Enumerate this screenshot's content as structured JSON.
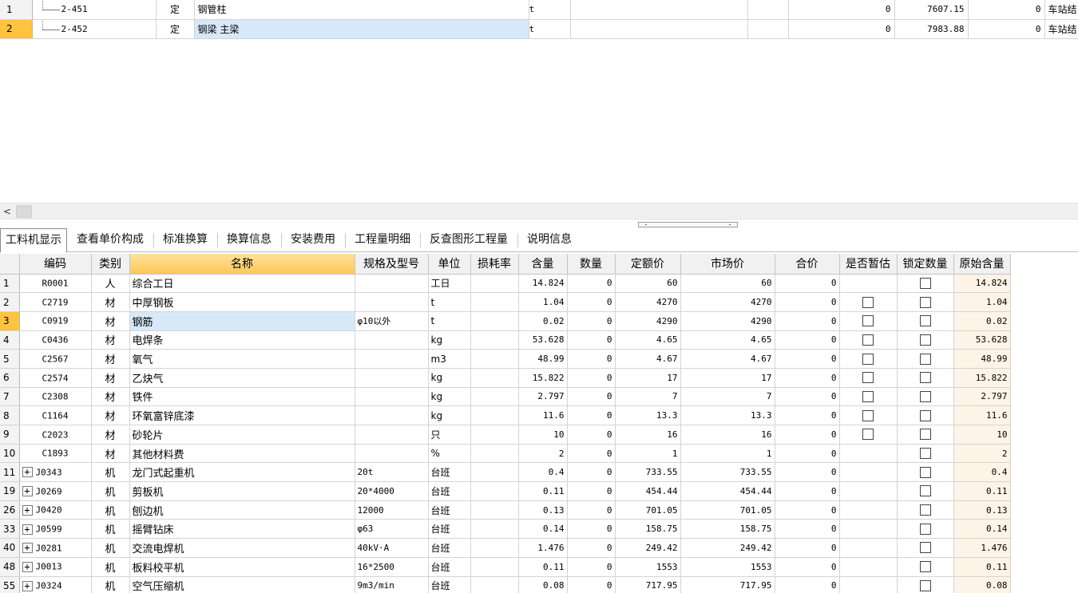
{
  "top_rows": [
    {
      "no": "1",
      "code": "2-451",
      "type": "定",
      "name": "钢管柱",
      "unit": "t",
      "c6": "",
      "c7": "",
      "qty": "0",
      "price": "7607.15",
      "total": "0",
      "category": "车站结"
    },
    {
      "no": "2",
      "code": "2-452",
      "type": "定",
      "name": "钢梁 主梁",
      "unit": "t",
      "c6": "",
      "c7": "",
      "qty": "0",
      "price": "7983.88",
      "total": "0",
      "category": "车站结"
    }
  ],
  "scrollbar": {
    "left_arrow": "<"
  },
  "tabs": [
    {
      "label": "工料机显示",
      "active": true
    },
    {
      "label": "查看单价构成"
    },
    {
      "label": "标准换算"
    },
    {
      "label": "换算信息"
    },
    {
      "label": "安装费用"
    },
    {
      "label": "工程量明细"
    },
    {
      "label": "反查图形工程量"
    },
    {
      "label": "说明信息"
    }
  ],
  "columns": [
    "",
    "编码",
    "类别",
    "名称",
    "规格及型号",
    "单位",
    "损耗率",
    "含量",
    "数量",
    "定额价",
    "市场价",
    "合价",
    "是否暂估",
    "锁定数量",
    "原始含量"
  ],
  "icons": {
    "checkbox": "checkbox-icon",
    "expand": "plus-expand-icon"
  },
  "rows": [
    {
      "no": "1",
      "code": "R0001",
      "type": "人",
      "name": "综合工日",
      "spec": "",
      "unit": "工日",
      "loss": "",
      "content": "14.824",
      "qty": "0",
      "quota_price": "60",
      "market_price": "60",
      "total": "0",
      "estimate_cb": false,
      "lock_cb": true,
      "original": "14.824",
      "expandable": false
    },
    {
      "no": "2",
      "code": "C2719",
      "type": "材",
      "name": "中厚钢板",
      "spec": "",
      "unit": "t",
      "loss": "",
      "content": "1.04",
      "qty": "0",
      "quota_price": "4270",
      "market_price": "4270",
      "total": "0",
      "estimate_cb": true,
      "lock_cb": true,
      "original": "1.04",
      "expandable": false
    },
    {
      "no": "3",
      "code": "C0919",
      "type": "材",
      "name": "钢筋",
      "spec": "φ10以外",
      "unit": "t",
      "loss": "",
      "content": "0.02",
      "qty": "0",
      "quota_price": "4290",
      "market_price": "4290",
      "total": "0",
      "estimate_cb": true,
      "lock_cb": true,
      "original": "0.02",
      "expandable": false,
      "selected": true
    },
    {
      "no": "4",
      "code": "C0436",
      "type": "材",
      "name": "电焊条",
      "spec": "",
      "unit": "kg",
      "loss": "",
      "content": "53.628",
      "qty": "0",
      "quota_price": "4.65",
      "market_price": "4.65",
      "total": "0",
      "estimate_cb": true,
      "lock_cb": true,
      "original": "53.628",
      "expandable": false
    },
    {
      "no": "5",
      "code": "C2567",
      "type": "材",
      "name": "氧气",
      "spec": "",
      "unit": "m3",
      "loss": "",
      "content": "48.99",
      "qty": "0",
      "quota_price": "4.67",
      "market_price": "4.67",
      "total": "0",
      "estimate_cb": true,
      "lock_cb": true,
      "original": "48.99",
      "expandable": false
    },
    {
      "no": "6",
      "code": "C2574",
      "type": "材",
      "name": "乙炔气",
      "spec": "",
      "unit": "kg",
      "loss": "",
      "content": "15.822",
      "qty": "0",
      "quota_price": "17",
      "market_price": "17",
      "total": "0",
      "estimate_cb": true,
      "lock_cb": true,
      "original": "15.822",
      "expandable": false
    },
    {
      "no": "7",
      "code": "C2308",
      "type": "材",
      "name": "铁件",
      "spec": "",
      "unit": "kg",
      "loss": "",
      "content": "2.797",
      "qty": "0",
      "quota_price": "7",
      "market_price": "7",
      "total": "0",
      "estimate_cb": true,
      "lock_cb": true,
      "original": "2.797",
      "expandable": false
    },
    {
      "no": "8",
      "code": "C1164",
      "type": "材",
      "name": "环氧富锌底漆",
      "spec": "",
      "unit": "kg",
      "loss": "",
      "content": "11.6",
      "qty": "0",
      "quota_price": "13.3",
      "market_price": "13.3",
      "total": "0",
      "estimate_cb": true,
      "lock_cb": true,
      "original": "11.6",
      "expandable": false
    },
    {
      "no": "9",
      "code": "C2023",
      "type": "材",
      "name": "砂轮片",
      "spec": "",
      "unit": "只",
      "loss": "",
      "content": "10",
      "qty": "0",
      "quota_price": "16",
      "market_price": "16",
      "total": "0",
      "estimate_cb": true,
      "lock_cb": true,
      "original": "10",
      "expandable": false
    },
    {
      "no": "10",
      "code": "C1893",
      "type": "材",
      "name": "其他材料费",
      "spec": "",
      "unit": "%",
      "loss": "",
      "content": "2",
      "qty": "0",
      "quota_price": "1",
      "market_price": "1",
      "total": "0",
      "estimate_cb": false,
      "lock_cb": true,
      "original": "2",
      "expandable": false
    },
    {
      "no": "11",
      "code": "J0343",
      "type": "机",
      "name": "龙门式起重机",
      "spec": "20t",
      "unit": "台班",
      "loss": "",
      "content": "0.4",
      "qty": "0",
      "quota_price": "733.55",
      "market_price": "733.55",
      "total": "0",
      "estimate_cb": false,
      "lock_cb": true,
      "original": "0.4",
      "expandable": true
    },
    {
      "no": "19",
      "code": "J0269",
      "type": "机",
      "name": "剪板机",
      "spec": "20*4000",
      "unit": "台班",
      "loss": "",
      "content": "0.11",
      "qty": "0",
      "quota_price": "454.44",
      "market_price": "454.44",
      "total": "0",
      "estimate_cb": false,
      "lock_cb": true,
      "original": "0.11",
      "expandable": true
    },
    {
      "no": "26",
      "code": "J0420",
      "type": "机",
      "name": "刨边机",
      "spec": "12000",
      "unit": "台班",
      "loss": "",
      "content": "0.13",
      "qty": "0",
      "quota_price": "701.05",
      "market_price": "701.05",
      "total": "0",
      "estimate_cb": false,
      "lock_cb": true,
      "original": "0.13",
      "expandable": true
    },
    {
      "no": "33",
      "code": "J0599",
      "type": "机",
      "name": "摇臂钻床",
      "spec": "φ63",
      "unit": "台班",
      "loss": "",
      "content": "0.14",
      "qty": "0",
      "quota_price": "158.75",
      "market_price": "158.75",
      "total": "0",
      "estimate_cb": false,
      "lock_cb": true,
      "original": "0.14",
      "expandable": true
    },
    {
      "no": "40",
      "code": "J0281",
      "type": "机",
      "name": "交流电焊机",
      "spec": "40kV·A",
      "unit": "台班",
      "loss": "",
      "content": "1.476",
      "qty": "0",
      "quota_price": "249.42",
      "market_price": "249.42",
      "total": "0",
      "estimate_cb": false,
      "lock_cb": true,
      "original": "1.476",
      "expandable": true
    },
    {
      "no": "48",
      "code": "J0013",
      "type": "机",
      "name": "板料校平机",
      "spec": "16*2500",
      "unit": "台班",
      "loss": "",
      "content": "0.11",
      "qty": "0",
      "quota_price": "1553",
      "market_price": "1553",
      "total": "0",
      "estimate_cb": false,
      "lock_cb": true,
      "original": "0.11",
      "expandable": true
    },
    {
      "no": "55",
      "code": "J0324",
      "type": "机",
      "name": "空气压缩机",
      "spec": "9m3/min",
      "unit": "台班",
      "loss": "",
      "content": "0.08",
      "qty": "0",
      "quota_price": "717.95",
      "market_price": "717.95",
      "total": "0",
      "estimate_cb": false,
      "lock_cb": true,
      "original": "0.08",
      "expandable": true
    }
  ]
}
